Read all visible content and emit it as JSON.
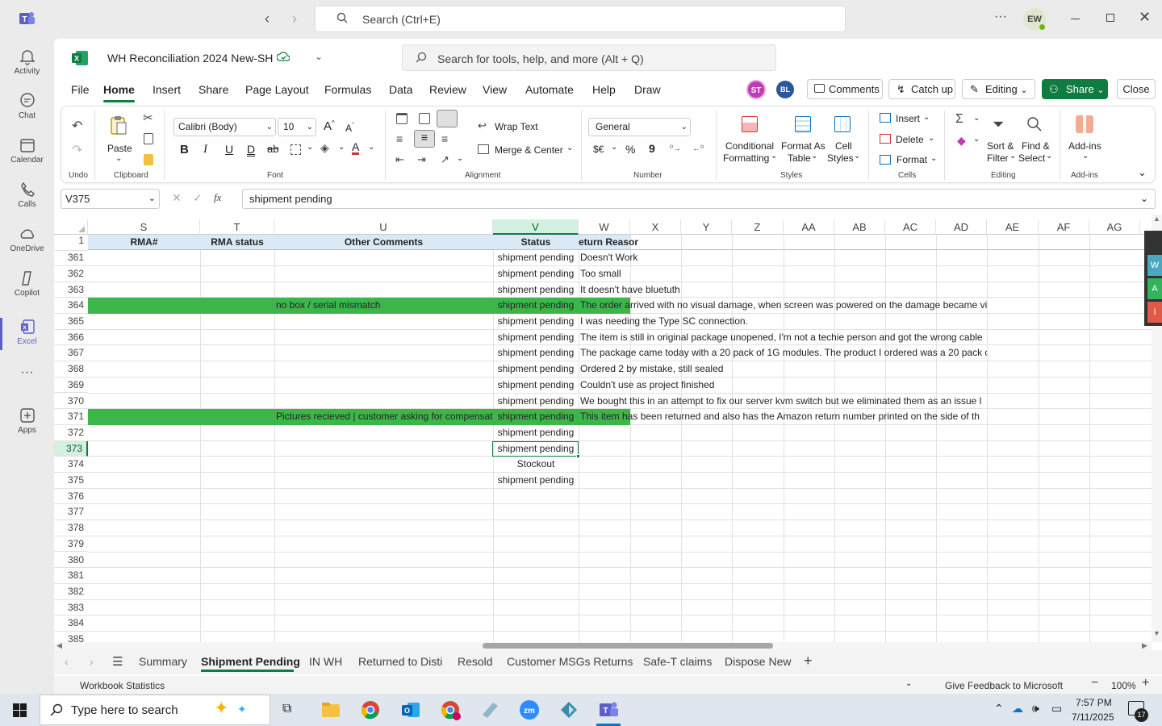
{
  "titlebar": {
    "search_placeholder": "Search (Ctrl+E)",
    "more": "···",
    "avatar": "EW"
  },
  "rail": {
    "items": [
      {
        "label": "Activity"
      },
      {
        "label": "Chat"
      },
      {
        "label": "Calendar"
      },
      {
        "label": "Calls"
      },
      {
        "label": "OneDrive"
      },
      {
        "label": "Copilot"
      },
      {
        "label": "Excel"
      },
      {
        "label": "···"
      },
      {
        "label": "Apps"
      }
    ]
  },
  "doc": {
    "title": "WH Reconciliation 2024 New-SH",
    "search_placeholder": "Search for tools, help, and more (Alt + Q)"
  },
  "menu": {
    "tabs": [
      "File",
      "Home",
      "Insert",
      "Share",
      "Page Layout",
      "Formulas",
      "Data",
      "Review",
      "View",
      "Automate",
      "Help",
      "Draw"
    ],
    "avatar1": "ST",
    "avatar2": "BL",
    "comments": "Comments",
    "catchup": "Catch up",
    "editing": "Editing",
    "share": "Share",
    "close": "Close"
  },
  "ribbon": {
    "undo_label": "Undo",
    "paste": "Paste",
    "clipboard": "Clipboard",
    "font_name": "Calibri (Body)",
    "font_size": "10",
    "font_label": "Font",
    "wrap_text": "Wrap Text",
    "merge_center": "Merge & Center",
    "alignment_label": "Alignment",
    "number_format": "General",
    "currency": "$€",
    "percent": "%",
    "comma": "9",
    "number_label": "Number",
    "cond_fmt_1": "Conditional",
    "cond_fmt_2": "Formatting",
    "fmt_table_1": "Format As",
    "fmt_table_2": "Table",
    "cell_styles_1": "Cell",
    "cell_styles_2": "Styles",
    "styles_label": "Styles",
    "insert": "Insert",
    "delete": "Delete",
    "format": "Format",
    "cells_label": "Cells",
    "sort_1": "Sort &",
    "sort_2": "Filter",
    "find_1": "Find &",
    "find_2": "Select",
    "editing_label": "Editing",
    "addins": "Add-ins",
    "addins_label": "Add-ins"
  },
  "formula_bar": {
    "name_box": "V375",
    "fx": "fx",
    "value": "shipment pending"
  },
  "grid": {
    "columns": [
      "S",
      "T",
      "U",
      "V",
      "W",
      "X",
      "Y",
      "Z",
      "AA",
      "AB",
      "AC",
      "AD",
      "AE",
      "AF",
      "AG"
    ],
    "header_row": {
      "num": "1",
      "S": "RMA#",
      "T": "RMA status",
      "U": "Other Comments",
      "V": "Status",
      "W": "eturn Reason"
    },
    "rows": [
      {
        "num": "361",
        "U": "",
        "V": "shipment pending",
        "W": "Doesn't Work",
        "hl": false
      },
      {
        "num": "362",
        "U": "",
        "V": "shipment pending",
        "W": "Too small",
        "hl": false
      },
      {
        "num": "363",
        "U": "",
        "V": "shipment pending",
        "W": "It doesn't have bluetuth",
        "hl": false
      },
      {
        "num": "364",
        "U": "no box / serial mismatch",
        "V": "shipment pending",
        "W": "The order arrived with no visual damage, when screen was powered on the damage became vi",
        "hl": true
      },
      {
        "num": "365",
        "U": "",
        "V": "shipment pending",
        "W": "I was needing the Type SC connection.",
        "hl": false
      },
      {
        "num": "366",
        "U": "",
        "V": "shipment pending",
        "W": "The item is still in original package unopened, I'm not a techie person and got the wrong cable",
        "hl": false
      },
      {
        "num": "367",
        "U": "",
        "V": "shipment pending",
        "W": "The package came today with a 20 pack of 1G modules.  The product I ordered was a 20 pack c",
        "hl": false
      },
      {
        "num": "368",
        "U": "",
        "V": "shipment pending",
        "W": "Ordered 2 by mistake, still sealed",
        "hl": false
      },
      {
        "num": "369",
        "U": "",
        "V": "shipment pending",
        "W": "Couldn't use as project finished",
        "hl": false
      },
      {
        "num": "370",
        "U": "",
        "V": "shipment pending",
        "W": "We bought this in an attempt to fix our server kvm switch but we eliminated them as an issue l",
        "hl": false
      },
      {
        "num": "371",
        "U": "Pictures recieved | customer asking for compensat",
        "V": "shipment pending",
        "W": "This item has been returned and also has the Amazon return number printed on the side of th",
        "hl": true
      },
      {
        "num": "372",
        "U": "",
        "V": "shipment pending",
        "W": "",
        "hl": false
      },
      {
        "num": "373",
        "U": "",
        "V": "shipment pending",
        "W": "",
        "hl": false
      },
      {
        "num": "374",
        "U": "",
        "V": "Stockout",
        "W": "",
        "hl": false
      },
      {
        "num": "375",
        "U": "",
        "V": "shipment pending",
        "W": "",
        "hl": false
      },
      {
        "num": "376",
        "U": "",
        "V": "",
        "W": "",
        "hl": false
      },
      {
        "num": "377",
        "U": "",
        "V": "",
        "W": "",
        "hl": false
      },
      {
        "num": "378",
        "U": "",
        "V": "",
        "W": "",
        "hl": false
      },
      {
        "num": "379",
        "U": "",
        "V": "",
        "W": "",
        "hl": false
      },
      {
        "num": "380",
        "U": "",
        "V": "",
        "W": "",
        "hl": false
      },
      {
        "num": "381",
        "U": "",
        "V": "",
        "W": "",
        "hl": false
      },
      {
        "num": "382",
        "U": "",
        "V": "",
        "W": "",
        "hl": false
      },
      {
        "num": "383",
        "U": "",
        "V": "",
        "W": "",
        "hl": false
      },
      {
        "num": "384",
        "U": "",
        "V": "",
        "W": "",
        "hl": false
      },
      {
        "num": "385",
        "U": "",
        "V": "",
        "W": "",
        "hl": false
      }
    ]
  },
  "side_tabs": [
    "W",
    "A",
    "I"
  ],
  "sheets": [
    "Summary",
    "Shipment Pending",
    "IN WH",
    "Returned to Disti",
    "Resold",
    "Customer MSGs Returns",
    "Safe-T claims",
    "Dispose New"
  ],
  "statusbar": {
    "left": "Workbook Statistics",
    "feedback": "Give Feedback to Microsoft",
    "zoom": "100%"
  },
  "taskbar": {
    "search_placeholder": "Type here to search",
    "time": "7:57 PM",
    "date": "7/11/2025",
    "notif": "17"
  },
  "colors": {
    "accent_green": "#107c41",
    "highlight": "#3cb54a",
    "header_fill": "#dbe9f6",
    "teams_purple": "#5b5fc7"
  }
}
